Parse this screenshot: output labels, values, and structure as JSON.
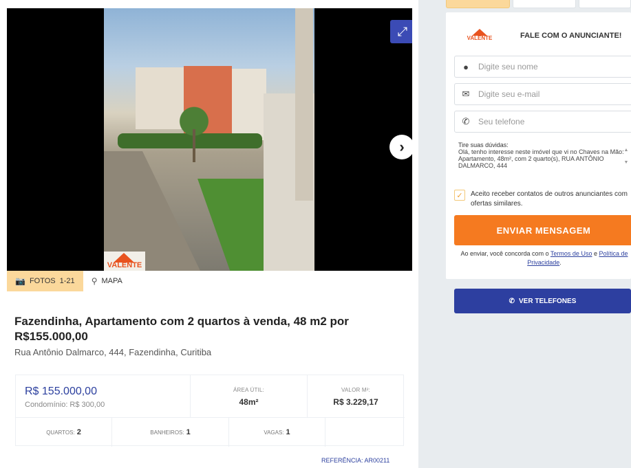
{
  "gallery": {
    "expand_icon": "expand-icon",
    "next_icon": "chevron-right-icon",
    "watermark": "VALENTE"
  },
  "media_tabs": [
    {
      "icon": "camera-icon",
      "label": "FOTOS",
      "count": "1-21"
    },
    {
      "icon": "map-pin-icon",
      "label": "MAPA"
    }
  ],
  "listing": {
    "title": "Fazendinha, Apartamento com 2 quartos à venda, 48 m2 por R$155.000,00",
    "address": "Rua Antônio Dalmarco, 444, Fazendinha, Curitiba",
    "price": "R$ 155.000,00",
    "condo": "Condomínio: R$ 300,00",
    "area_label": "ÁREA ÚTIL:",
    "area_value": "48m²",
    "m2_label": "VALOR M²:",
    "m2_value": "R$ 3.229,17",
    "rooms_label": "QUARTOS:",
    "rooms_value": "2",
    "baths_label": "BANHEIROS:",
    "baths_value": "1",
    "spots_label": "VAGAS:",
    "spots_value": "1",
    "reference": "REFERÊNCIA: AR00211"
  },
  "contact": {
    "logo": "VALENTE",
    "title": "FALE COM O ANUNCIANTE!",
    "name_placeholder": "Digite seu nome",
    "email_placeholder": "Digite seu e-mail",
    "phone_placeholder": "Seu telefone",
    "message_head": "Tire suas dúvidas:",
    "message_body": "Olá, tenho interesse neste imóvel que vi no Chaves na Mão: Apartamento, 48m², com 2 quarto(s), RUA ANTÔNIO DALMARCO, 444",
    "optin": "Aceito receber contatos de outros anunciantes com ofertas similares.",
    "send_label": "ENVIAR MENSAGEM",
    "terms_pre": "Ao enviar, você concorda com o ",
    "terms_link": "Termos de Uso",
    "terms_mid": " e ",
    "privacy_link": "Política de Privacidade",
    "terms_end": ".",
    "phone_button": "VER TELEFONES"
  },
  "colors": {
    "accent": "#f57a20",
    "primary": "#2d3fa0",
    "tab_active": "#fbd89b"
  }
}
